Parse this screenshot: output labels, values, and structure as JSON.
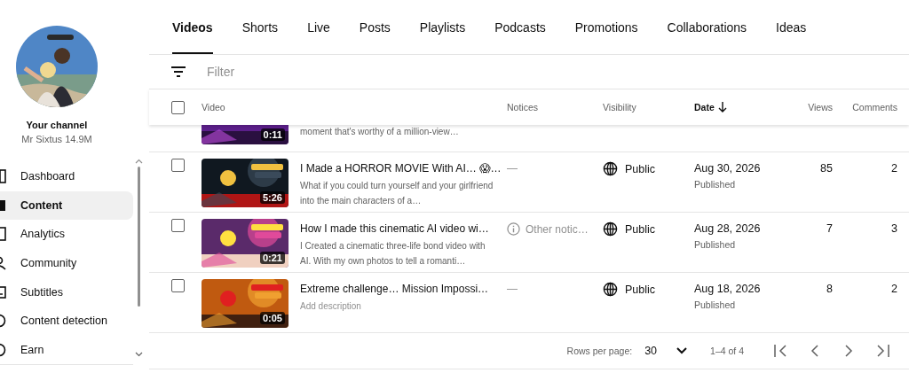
{
  "channel": {
    "label": "Your channel",
    "name": "Mr Sixtus 14.9M"
  },
  "sidebar": {
    "items": [
      {
        "label": "Dashboard",
        "selected": false
      },
      {
        "label": "Content",
        "selected": true
      },
      {
        "label": "Analytics",
        "selected": false
      },
      {
        "label": "Community",
        "selected": false
      },
      {
        "label": "Subtitles",
        "selected": false
      },
      {
        "label": "Content detection",
        "selected": false
      },
      {
        "label": "Earn",
        "selected": false
      }
    ]
  },
  "tabs": [
    {
      "label": "Videos",
      "selected": true
    },
    {
      "label": "Shorts",
      "selected": false
    },
    {
      "label": "Live",
      "selected": false
    },
    {
      "label": "Posts",
      "selected": false
    },
    {
      "label": "Playlists",
      "selected": false
    },
    {
      "label": "Podcasts",
      "selected": false
    },
    {
      "label": "Promotions",
      "selected": false
    },
    {
      "label": "Collaborations",
      "selected": false
    },
    {
      "label": "Ideas",
      "selected": false
    }
  ],
  "filter": {
    "placeholder": "Filter"
  },
  "table": {
    "select_all": {
      "checked": false
    },
    "columns": [
      {
        "label": "Video",
        "sorted": false
      },
      {
        "label": "Notices",
        "sorted": false
      },
      {
        "label": "Visibility",
        "sorted": false
      },
      {
        "label": "Date",
        "sorted": true
      },
      {
        "label": "Views",
        "sorted": false
      },
      {
        "label": "Comments",
        "sorted": false
      }
    ],
    "rows": [
      {
        "kind": "partial",
        "duration": "0:11",
        "description": "moment that's worthy of a million-view…"
      },
      {
        "kind": "full",
        "checked": false,
        "duration": "5:26",
        "title": "I Made a HORROR MOVIE With AI… 😱…",
        "description": "What if you could turn yourself and your girlfriend into the main characters of a…",
        "description_is_hint": false,
        "notice": {
          "kind": "none",
          "text": "—"
        },
        "visibility": "Public",
        "date": "Aug 30, 2026",
        "status": "Published",
        "views": "85",
        "comments": "2"
      },
      {
        "kind": "full",
        "checked": false,
        "duration": "0:21",
        "title": "How I made this cinematic AI video wi…",
        "description": "I Created a cinematic three-life bond video with AI. With my own photos to tell a romanti…",
        "description_is_hint": false,
        "notice": {
          "kind": "info",
          "text": "Other notic…"
        },
        "visibility": "Public",
        "date": "Aug 28, 2026",
        "status": "Published",
        "views": "7",
        "comments": "3"
      },
      {
        "kind": "full",
        "checked": false,
        "duration": "0:05",
        "title": "Extreme challenge… Mission Impossi…",
        "description": "Add description",
        "description_is_hint": true,
        "notice": {
          "kind": "none",
          "text": "—"
        },
        "visibility": "Public",
        "date": "Aug 18, 2026",
        "status": "Published",
        "views": "8",
        "comments": "2"
      }
    ]
  },
  "pagination": {
    "rows_label": "Rows per page:",
    "rows_value": "30",
    "range": "1–4 of 4"
  }
}
